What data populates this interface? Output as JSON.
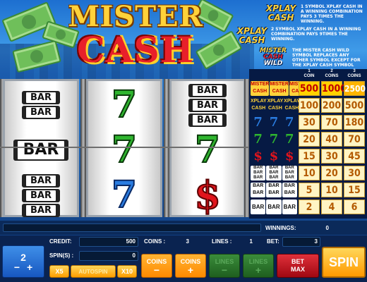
{
  "logo": {
    "line1": "MISTER",
    "line2": "CASH"
  },
  "badges": {
    "xplay_cash_1": {
      "line1": "XPLAY",
      "line2": "CASH"
    },
    "xplay_cash_2": {
      "line1": "XPLAY",
      "line2": "CASH"
    },
    "wild": {
      "line1": "MISTER",
      "line2": "CASH",
      "line3": "WILD"
    }
  },
  "rules": [
    "1 SYMBOL XPLAY CASH IN A WINNING COMBINATION PAYS 3 TIMES THE WINNING.",
    "2 SYMBOL XPLAY CASH IN A WINNING COMBINATION PAYS 9TIMES THE WINNING.",
    "THE  MISTER CASH WILD SYMBOL REPLACES ANY OTHER  SYMBOL EXCEPT FOR THE  XPLAY CASH SYMBOL"
  ],
  "reels": [
    [
      "BAR BAR",
      "BAR",
      "BAR BAR BAR"
    ],
    [
      "7",
      "7",
      "7"
    ],
    [
      "BAR BAR BAR",
      "7",
      "$"
    ]
  ],
  "paytable": {
    "headers": [
      {
        "num": "1",
        "label": "COIN"
      },
      {
        "num": "2",
        "label": "COINS"
      },
      {
        "num": "3",
        "label": "COINS"
      }
    ],
    "rows": [
      {
        "symbol": "MISTER CASH",
        "values": [
          "500",
          "1000",
          "2500"
        ]
      },
      {
        "symbol": "XPLAY CASH",
        "values": [
          "100",
          "200",
          "500"
        ]
      },
      {
        "symbol": "7",
        "values": [
          "30",
          "70",
          "180"
        ]
      },
      {
        "symbol": "7",
        "values": [
          "20",
          "40",
          "70"
        ]
      },
      {
        "symbol": "$",
        "values": [
          "15",
          "30",
          "45"
        ]
      },
      {
        "symbol": "BAR",
        "values": [
          "10",
          "20",
          "30"
        ]
      },
      {
        "symbol": "BAR",
        "values": [
          "5",
          "10",
          "15"
        ]
      },
      {
        "symbol": "BAR",
        "values": [
          "2",
          "4",
          "6"
        ]
      }
    ]
  },
  "status": {
    "winnings_label": "WINNINGS:",
    "winnings_value": "0",
    "credit_label": "CREDIT:",
    "credit_value": "500",
    "coins_label": "COINS :",
    "coins_value": "3",
    "lines_label": "LINES :",
    "lines_value": "1",
    "bet_label": "BET:",
    "bet_value": "3",
    "spins_label": "SPIN(S) :",
    "spins_value": "0"
  },
  "controls": {
    "spin_count": "2",
    "minus": "−",
    "plus": "+",
    "x5": "X5",
    "autospin": "AUTOSPIN",
    "x10": "X10",
    "coins_minus_label": "COINS",
    "coins_plus_label": "COINS",
    "lines_minus_label": "LINES",
    "lines_plus_label": "LINES",
    "bet_max_line1": "BET",
    "bet_max_line2": "MAX",
    "spin": "SPIN"
  }
}
